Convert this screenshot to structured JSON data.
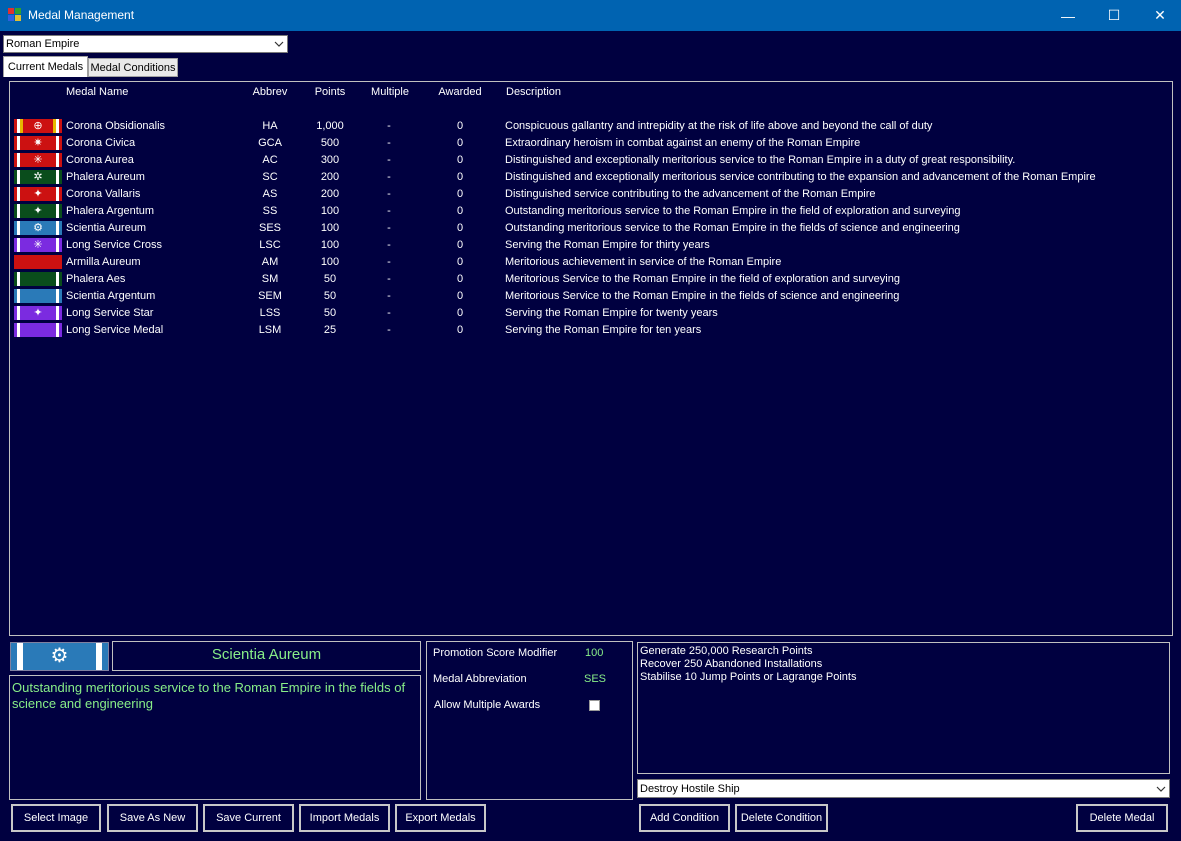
{
  "window": {
    "title": "Medal Management",
    "minimize_glyph": "—",
    "maximize_glyph": "☐",
    "close_glyph": "✕"
  },
  "race_select": {
    "value": "Roman Empire"
  },
  "tabs": [
    {
      "label": "Current Medals",
      "active": true
    },
    {
      "label": "Medal Conditions",
      "active": false
    }
  ],
  "columns": {
    "name": "Medal Name",
    "abbrev": "Abbrev",
    "points": "Points",
    "multiple": "Multiple",
    "awarded": "Awarded",
    "description": "Description"
  },
  "medals": [
    {
      "name": "Corona Obsidionalis",
      "abbrev": "HA",
      "points": "1,000",
      "multiple": "-",
      "awarded": "0",
      "description": "Conspicuous gallantry and intrepidity at the risk of life above and beyond the call of duty",
      "ribbon": [
        "#ffffff",
        "#cc1111",
        "#e6b800"
      ],
      "emblem": "⊕"
    },
    {
      "name": "Corona Civica",
      "abbrev": "GCA",
      "points": "500",
      "multiple": "-",
      "awarded": "0",
      "description": "Extraordinary heroism in combat against an enemy of the Roman Empire",
      "ribbon": [
        "#ffffff",
        "#cc1111",
        "#cc1111"
      ],
      "emblem": "✷"
    },
    {
      "name": "Corona Aurea",
      "abbrev": "AC",
      "points": "300",
      "multiple": "-",
      "awarded": "0",
      "description": "Distinguished and exceptionally meritorious service to the Roman Empire in a duty of great responsibility.",
      "ribbon": [
        "#ffffff",
        "#cc1111",
        "#cc1111"
      ],
      "emblem": "✳"
    },
    {
      "name": "Phalera Aureum",
      "abbrev": "SC",
      "points": "200",
      "multiple": "-",
      "awarded": "0",
      "description": "Distinguished and exceptionally meritorious service contributing to the expansion and advancement of the Roman Empire",
      "ribbon": [
        "#ffffff",
        "#0a4d1c",
        "#0a4d1c"
      ],
      "emblem": "✲"
    },
    {
      "name": "Corona Vallaris",
      "abbrev": "AS",
      "points": "200",
      "multiple": "-",
      "awarded": "0",
      "description": "Distinguished service contributing to the advancement of the Roman Empire",
      "ribbon": [
        "#ffffff",
        "#cc1111",
        "#cc1111"
      ],
      "emblem": "✦"
    },
    {
      "name": "Phalera Argentum",
      "abbrev": "SS",
      "points": "100",
      "multiple": "-",
      "awarded": "0",
      "description": "Outstanding meritorious service to the Roman Empire in the field of exploration and surveying",
      "ribbon": [
        "#ffffff",
        "#0a4d1c",
        "#0a4d1c"
      ],
      "emblem": "✦"
    },
    {
      "name": "Scientia Aureum",
      "abbrev": "SES",
      "points": "100",
      "multiple": "-",
      "awarded": "0",
      "description": "Outstanding meritorious service to the Roman Empire in the fields of science and engineering",
      "ribbon": [
        "#ffffff",
        "#2a7ab8",
        "#2a7ab8"
      ],
      "emblem": "⚙"
    },
    {
      "name": "Long Service Cross",
      "abbrev": "LSC",
      "points": "100",
      "multiple": "-",
      "awarded": "0",
      "description": "Serving the Roman Empire for thirty years",
      "ribbon": [
        "#ffffff",
        "#7b2be0",
        "#7b2be0"
      ],
      "emblem": "✳"
    },
    {
      "name": "Armilla Aureum",
      "abbrev": "AM",
      "points": "100",
      "multiple": "-",
      "awarded": "0",
      "description": "Meritorious achievement in service of the Roman Empire",
      "ribbon": [
        "#cc1111",
        "#cc1111",
        "#cc1111"
      ],
      "emblem": ""
    },
    {
      "name": "Phalera Aes",
      "abbrev": "SM",
      "points": "50",
      "multiple": "-",
      "awarded": "0",
      "description": "Meritorious Service to the Roman Empire in the field of exploration and surveying",
      "ribbon": [
        "#ffffff",
        "#0a4d1c",
        "#0a4d1c"
      ],
      "emblem": ""
    },
    {
      "name": "Scientia Argentum",
      "abbrev": "SEM",
      "points": "50",
      "multiple": "-",
      "awarded": "0",
      "description": "Meritorious Service to the Roman Empire in the fields of science and engineering",
      "ribbon": [
        "#ffffff",
        "#2a7ab8",
        "#2a7ab8"
      ],
      "emblem": ""
    },
    {
      "name": "Long Service Star",
      "abbrev": "LSS",
      "points": "50",
      "multiple": "-",
      "awarded": "0",
      "description": "Serving the Roman Empire for twenty years",
      "ribbon": [
        "#ffffff",
        "#7b2be0",
        "#7b2be0"
      ],
      "emblem": "✦"
    },
    {
      "name": "Long Service Medal",
      "abbrev": "LSM",
      "points": "25",
      "multiple": "-",
      "awarded": "0",
      "description": "Serving the Roman Empire for ten years",
      "ribbon": [
        "#ffffff",
        "#7b2be0",
        "#7b2be0"
      ],
      "emblem": ""
    }
  ],
  "selected": {
    "name": "Scientia Aureum",
    "description": "Outstanding meritorious service to the Roman Empire in the fields of science and engineering",
    "emblem": "⚙"
  },
  "properties": {
    "promotion_label": "Promotion Score Modifier",
    "promotion_value": "100",
    "abbrev_label": "Medal Abbreviation",
    "abbrev_value": "SES",
    "multiple_label": "Allow Multiple Awards",
    "multiple_checked": false
  },
  "conditions": [
    "Generate 250,000 Research Points",
    "Recover 250 Abandoned Installations",
    "Stabilise 10 Jump Points or Lagrange Points"
  ],
  "condition_select": {
    "value": "Destroy Hostile Ship"
  },
  "buttons": {
    "select_image": "Select Image",
    "save_as_new": "Save As New",
    "save_current": "Save Current",
    "import_medals": "Import Medals",
    "export_medals": "Export Medals",
    "add_condition": "Add Condition",
    "delete_condition": "Delete Condition",
    "delete_medal": "Delete Medal"
  },
  "colors": {
    "background": "#000040",
    "titlebar": "#0063b1",
    "accent_text": "#88ee88"
  }
}
